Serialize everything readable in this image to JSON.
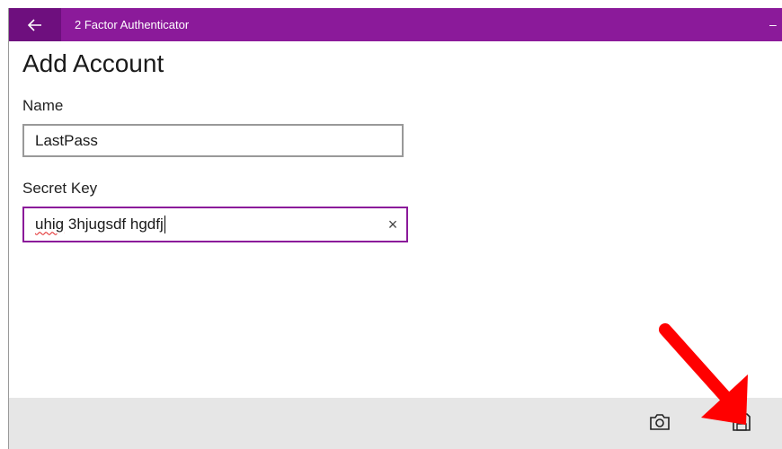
{
  "window": {
    "title": "2 Factor Authenticator",
    "accent_color": "#8b1a9a",
    "back_icon": "back-arrow-icon",
    "minimize_label": "–"
  },
  "page": {
    "title": "Add Account"
  },
  "form": {
    "name_label": "Name",
    "name_value": "LastPass",
    "secret_label": "Secret Key",
    "secret_value_misspelled": "uhig",
    "secret_value_rest": " 3hjugsdf hgdfj",
    "clear_icon": "×"
  },
  "app_bar": {
    "camera_icon": "camera-icon",
    "save_icon": "save-icon"
  },
  "annotation": {
    "arrow_color": "#ff0000"
  }
}
